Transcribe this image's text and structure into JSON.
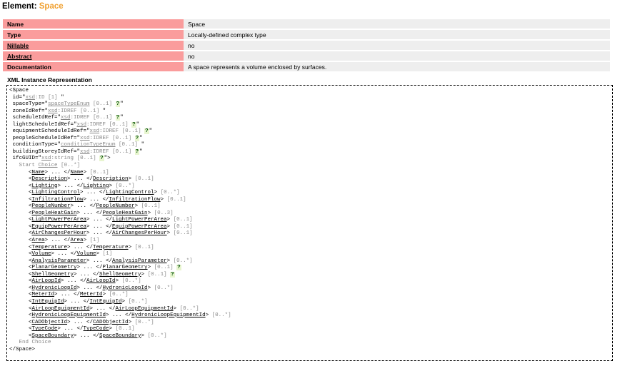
{
  "title": {
    "prefix": "Element: ",
    "name": "Space"
  },
  "properties": [
    {
      "key": "Name",
      "value": "Space",
      "underline": false
    },
    {
      "key": "Type",
      "value": "Locally-defined complex type",
      "underline": false
    },
    {
      "key": "Nillable",
      "value": "no",
      "underline": true
    },
    {
      "key": "Abstract",
      "value": "no",
      "underline": true
    },
    {
      "key": "Documentation",
      "value": "A space represents a volume enclosed by surfaces.",
      "underline": false
    }
  ],
  "xml_title": "XML Instance Representation",
  "xml": {
    "open_tag": "<Space",
    "attributes": [
      {
        "name": "id",
        "type_prefix": "",
        "type": "xsd",
        "type_suffix": ":ID",
        "occ": "[1]",
        "help": false
      },
      {
        "name": "spaceType",
        "type_prefix": "",
        "type": "spaceTypeEnum",
        "type_suffix": "",
        "occ": "[0..1]",
        "help": true
      },
      {
        "name": "zoneIdRef",
        "type_prefix": "",
        "type": "xsd",
        "type_suffix": ":IDREF",
        "occ": "[0..1]",
        "help": false
      },
      {
        "name": "scheduleIdRef",
        "type_prefix": "",
        "type": "xsd",
        "type_suffix": ":IDREF",
        "occ": "[0..1]",
        "help": true
      },
      {
        "name": "lightScheduleIdRef",
        "type_prefix": "",
        "type": "xsd",
        "type_suffix": ":IDREF",
        "occ": "[0..1]",
        "help": true
      },
      {
        "name": "equipmentScheduleIdRef",
        "type_prefix": "",
        "type": "xsd",
        "type_suffix": ":IDREF",
        "occ": "[0..1]",
        "help": true
      },
      {
        "name": "peopleScheduleIdRef",
        "type_prefix": "",
        "type": "xsd",
        "type_suffix": ":IDREF",
        "occ": "[0..1]",
        "help": true
      },
      {
        "name": "conditionType",
        "type_prefix": "",
        "type": "conditionTypeEnum",
        "type_suffix": "",
        "occ": "[0..1]",
        "help": false
      },
      {
        "name": "buildingStoreyIdRef",
        "type_prefix": "",
        "type": "xsd",
        "type_suffix": ":IDREF",
        "occ": "[0..1]",
        "help": true
      },
      {
        "name": "ifcGUID",
        "type_prefix": "",
        "type": "xsd",
        "type_suffix": ":string",
        "occ": "[0..1]",
        "help": true,
        "closes": true
      }
    ],
    "start_choice": {
      "label": "Start ",
      "link": "Choice",
      "occ": "[0..*]"
    },
    "elements": [
      {
        "name": "Name",
        "occ": "[0..1]",
        "help": false
      },
      {
        "name": "Description",
        "occ": "[0..1]",
        "help": false
      },
      {
        "name": "Lighting",
        "occ": "[0..*]",
        "help": false
      },
      {
        "name": "LightingControl",
        "occ": "[0..*]",
        "help": false
      },
      {
        "name": "InfiltrationFlow",
        "occ": "[0..1]",
        "help": false
      },
      {
        "name": "PeopleNumber",
        "occ": "[0..1]",
        "help": false
      },
      {
        "name": "PeopleHeatGain",
        "occ": "[0..3]",
        "help": false
      },
      {
        "name": "LightPowerPerArea",
        "occ": "[0..1]",
        "help": false
      },
      {
        "name": "EquipPowerPerArea",
        "occ": "[0..1]",
        "help": false
      },
      {
        "name": "AirChangesPerHour",
        "occ": "[0..1]",
        "help": false
      },
      {
        "name": "Area",
        "occ": "[1]",
        "help": false
      },
      {
        "name": "Temperature",
        "occ": "[0..1]",
        "help": false
      },
      {
        "name": "Volume",
        "occ": "[1]",
        "help": false
      },
      {
        "name": "AnalysisParameter",
        "occ": "[0..*]",
        "help": false
      },
      {
        "name": "PlanarGeometry",
        "occ": "[0..1]",
        "help": true
      },
      {
        "name": "ShellGeometry",
        "occ": "[0..1]",
        "help": true
      },
      {
        "name": "AirLoopId",
        "occ": "[0..*]",
        "help": false
      },
      {
        "name": "HydronicLoopId",
        "occ": "[0..*]",
        "help": false
      },
      {
        "name": "MeterId",
        "occ": "[0..*]",
        "help": false
      },
      {
        "name": "IntEquipId",
        "occ": "[0..*]",
        "help": false
      },
      {
        "name": "AirLoopEquipmentId",
        "occ": "[0..*]",
        "help": false
      },
      {
        "name": "HydronicLoopEquipmentId",
        "occ": "[0..*]",
        "help": false
      },
      {
        "name": "CADObjectId",
        "occ": "[0..*]",
        "help": false
      },
      {
        "name": "TypeCode",
        "occ": "[0..1]",
        "help": false
      },
      {
        "name": "SpaceBoundary",
        "occ": "[0..*]",
        "help": false
      }
    ],
    "end_choice": "End Choice",
    "close_tag": "</Space>",
    "help_glyph": "?",
    "gt": ">"
  }
}
